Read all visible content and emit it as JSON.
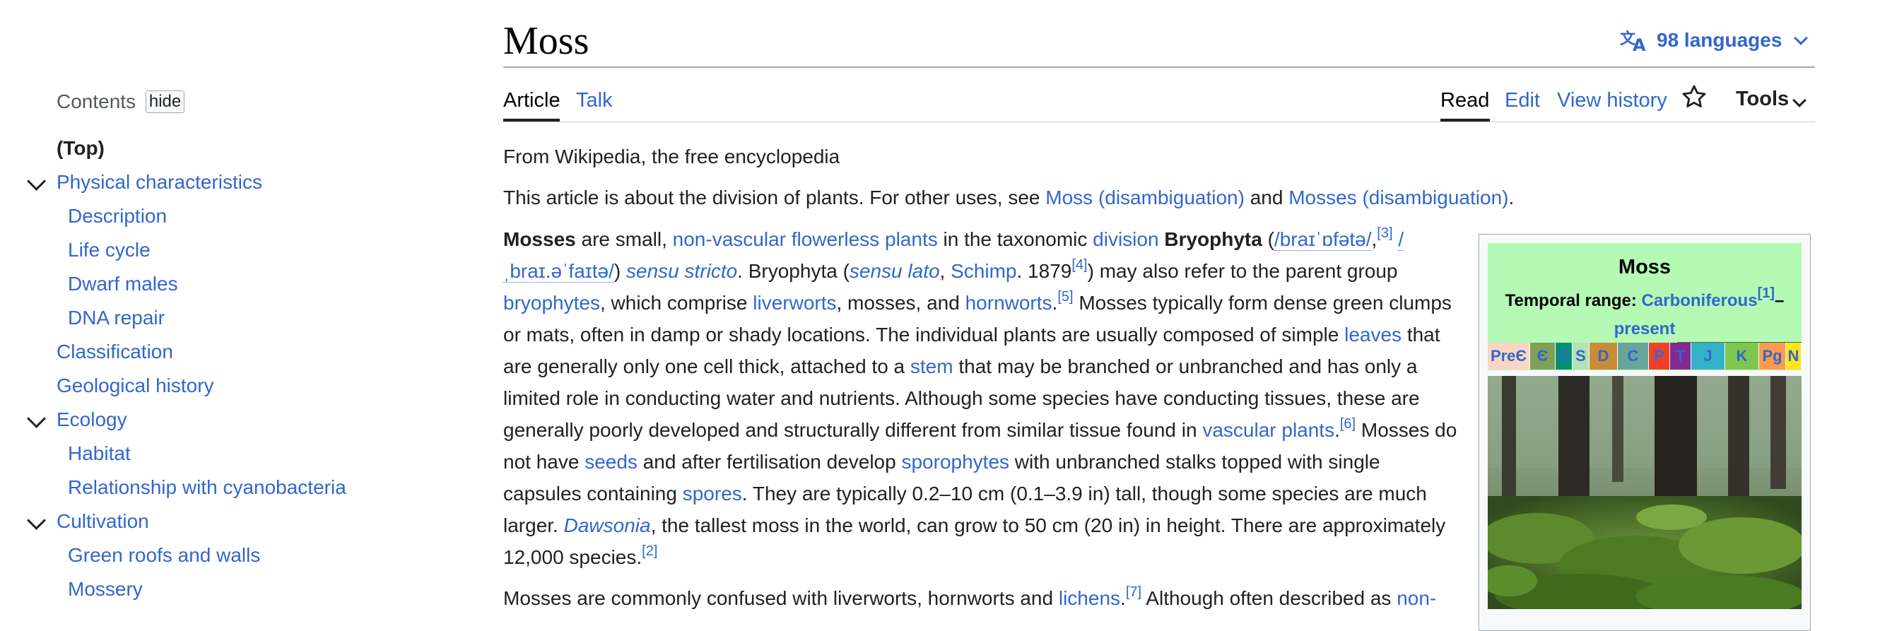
{
  "toc": {
    "heading": "Contents",
    "hide_label": "hide",
    "items": [
      {
        "label": "(Top)"
      },
      {
        "label": "Physical characteristics"
      },
      {
        "label": "Description"
      },
      {
        "label": "Life cycle"
      },
      {
        "label": "Dwarf males"
      },
      {
        "label": "DNA repair"
      },
      {
        "label": "Classification"
      },
      {
        "label": "Geological history"
      },
      {
        "label": "Ecology"
      },
      {
        "label": "Habitat"
      },
      {
        "label": "Relationship with cyanobacteria"
      },
      {
        "label": "Cultivation"
      },
      {
        "label": "Green roofs and walls"
      },
      {
        "label": "Mossery"
      }
    ]
  },
  "header": {
    "title": "Moss",
    "languages": "98 languages",
    "tabs": {
      "article": "Article",
      "talk": "Talk",
      "read": "Read",
      "edit": "Edit",
      "history": "View history",
      "tools": "Tools"
    }
  },
  "content": {
    "from": "From Wikipedia, the free encyclopedia",
    "hatnote": {
      "pre": "This article is about the division of plants. For other uses, see ",
      "link1": "Moss (disambiguation)",
      "mid": " and ",
      "link2": "Mosses (disambiguation)",
      "post": "."
    },
    "p1": {
      "mosses": "Mosses",
      "t1": " are small, ",
      "l_nonvasc": "non-vascular flowerless plants",
      "t2": " in the taxonomic ",
      "l_division": "division",
      "t3": " ",
      "bryophyta": "Bryophyta",
      "t4": " (",
      "ipa1": "/braɪˈɒfətə/",
      "t5": ",",
      "ref3": "[3]",
      "ipa2": "/ˌbraɪ.əˈfaɪtə/",
      "t6": ") ",
      "sensu_stricto": "sensu stricto",
      "t7": ". Bryophyta (",
      "sensu_lato": "sensu lato",
      "t8": ", ",
      "l_schimp": "Schimp",
      "t9": ". 1879",
      "ref4": "[4]",
      "t10": ") may also refer to the parent group ",
      "l_bryophytes": "bryophytes",
      "t11": ", which comprise ",
      "l_liverworts": "liverworts",
      "t12": ", mosses, and ",
      "l_hornworts": "hornworts",
      "t13": ".",
      "ref5": "[5]",
      "t14": " Mosses typically form dense green clumps or mats, often in damp or shady locations. The individual plants are usually composed of simple ",
      "l_leaves": "leaves",
      "t15": " that are generally only one cell thick, attached to a ",
      "l_stem": "stem",
      "t16": " that may be branched or unbranched and has only a limited role in conducting water and nutrients. Although some species have conducting tissues, these are generally poorly developed and structurally different from similar tissue found in ",
      "l_vascular": "vascular plants",
      "t17": ".",
      "ref6": "[6]",
      "t18": " Mosses do not have ",
      "l_seeds": "seeds",
      "t19": " and after fertilisation develop ",
      "l_sporophytes": "sporophytes",
      "t20": " with unbranched stalks topped with single capsules containing ",
      "l_spores": "spores",
      "t21": ". They are typically 0.2–10 cm (0.1–3.9 in) tall, though some species are much larger. ",
      "l_dawsonia": "Dawsonia",
      "t22": ", the tallest moss in the world, can grow to 50 cm (20 in) in height. There are approximately 12,000 species.",
      "ref2": "[2]"
    },
    "p2": {
      "t1": "Mosses are commonly confused with liverworts, hornworts and ",
      "l_lichens": "lichens",
      "t2": ".",
      "ref7": "[7]",
      "t3": " Although often described as ",
      "l_non": "non-"
    }
  },
  "infobox": {
    "name": "Moss",
    "range_label": "Temporal range: ",
    "range_link": "Carboniferous",
    "range_ref": "[1]",
    "range_dash": "–",
    "range_end": "present",
    "periods": [
      {
        "label": "PreЄ",
        "color": "#f7d7c4"
      },
      {
        "label": "Є",
        "color": "#7fa056"
      },
      {
        "label": "O",
        "color": "#009270"
      },
      {
        "label": "S",
        "color": "#b3e1b6"
      },
      {
        "label": "D",
        "color": "#cb8c37"
      },
      {
        "label": "C",
        "color": "#67a599"
      },
      {
        "label": "P",
        "color": "#f04028"
      },
      {
        "label": "T",
        "color": "#812b92"
      },
      {
        "label": "J",
        "color": "#34b2c9"
      },
      {
        "label": "K",
        "color": "#7fc64e"
      },
      {
        "label": "Pg",
        "color": "#fd9a52"
      },
      {
        "label": "N",
        "color": "#ffe619"
      }
    ]
  },
  "colors": {
    "link": "#3366cc",
    "text": "#202122",
    "infobox_header": "#b4fab4"
  }
}
